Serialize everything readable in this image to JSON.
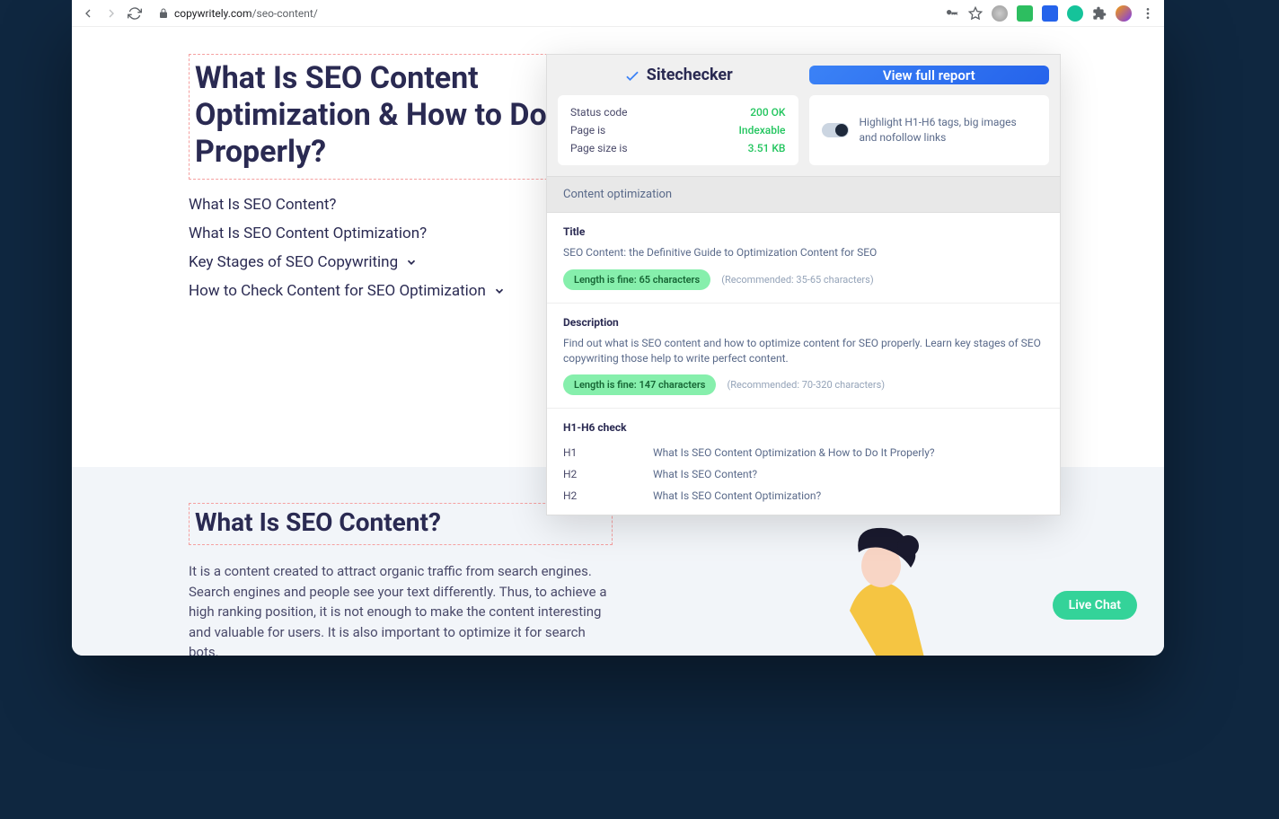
{
  "browser": {
    "url_domain": "copywritely.com",
    "url_path": "/seo-content/"
  },
  "page": {
    "h1_tag": "H1",
    "h1": "What Is SEO Content Optimization & How to Do It Properly?",
    "toc": [
      {
        "label": "What Is SEO Content?",
        "expandable": false
      },
      {
        "label": "What Is SEO Content Optimization?",
        "expandable": false
      },
      {
        "label": "Key Stages of SEO Copywriting",
        "expandable": true
      },
      {
        "label": "How to Check Content for SEO Optimization",
        "expandable": true
      }
    ],
    "h2_tag": "H2",
    "h2": "What Is SEO Content?",
    "body": "It is a content created to attract organic traffic from search engines. Search engines and people see your text differently. Thus, to achieve a high ranking position, it is not enough to make the content interesting and valuable for users. It is also important to optimize it for search bots.",
    "live_chat": "Live Chat"
  },
  "ext": {
    "brand": "Sitechecker",
    "report_btn": "View full report",
    "status": [
      {
        "label": "Status code",
        "value": "200 OK"
      },
      {
        "label": "Page is",
        "value": "Indexable"
      },
      {
        "label": "Page size is",
        "value": "3.51 KB"
      }
    ],
    "toggle_text": "Highlight H1-H6 tags, big images and nofollow links",
    "opt_header": "Content optimization",
    "title_section": {
      "label": "Title",
      "text": "SEO Content: the Definitive Guide to Optimization Content for SEO",
      "badge": "Length is fine: 65 characters",
      "rec": "(Recommended: 35-65 characters)"
    },
    "desc_section": {
      "label": "Description",
      "text": "Find out what is SEO content and how to optimize content for SEO properly. Learn key stages of SEO copywriting those help to write perfect content.",
      "badge": "Length is fine: 147 characters",
      "rec": "(Recommended: 70-320 characters)"
    },
    "h_section": {
      "label": "H1-H6 check",
      "rows": [
        {
          "tag": "H1",
          "text": "What Is SEO Content Optimization & How to Do It Properly?"
        },
        {
          "tag": "H2",
          "text": "What Is SEO Content?"
        },
        {
          "tag": "H2",
          "text": "What Is SEO Content Optimization?"
        }
      ]
    }
  }
}
